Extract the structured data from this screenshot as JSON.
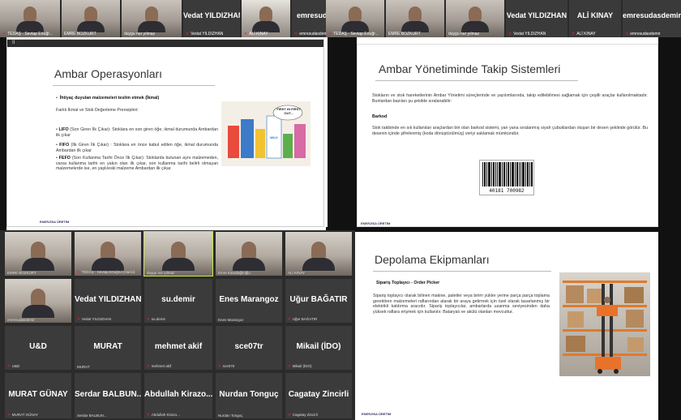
{
  "left_strip": {
    "tiles": [
      {
        "name": "TEDAŞ - Sevtap Ertuğr..."
      },
      {
        "name": "EMRE BOZKURT"
      },
      {
        "name": "duygu nur yılmaz"
      },
      {
        "name": "Vedat YILDIZHAN",
        "big": "Vedat YILDIZHAN"
      },
      {
        "name": "ALİ KINAY"
      },
      {
        "name": "emresudasdemir",
        "big": "emresudasdemir"
      }
    ]
  },
  "right_strip": {
    "tiles": [
      {
        "name": "TEDAŞ - Sevtap Ertuğr..."
      },
      {
        "name": "EMRE BOZKURT"
      },
      {
        "name": "duygu nur yılmaz"
      },
      {
        "name": "Vedat YILDIZHAN",
        "big": "Vedat YILDIZHAN"
      },
      {
        "name": "ALİ KINAY",
        "big": "ALİ KINAY"
      },
      {
        "name": "emresudasdemir",
        "big": "emresudasdemir"
      }
    ]
  },
  "slide1": {
    "bar": "II",
    "title": "Ambar Operasyonları",
    "bullet_main": "İhtiyaç duyulan malzemeleri teslim etmek (İkmal)",
    "subtitle": "Farklı İkmal ve Stok Değerleme Prensipleri:",
    "lifo_key": "LIFO",
    "lifo_text": " (Son Giren İlk Çıkar): Stoklara en son giren öğe, ikmal durumunda Ambardan ilk çıkar",
    "fifo_key": "FIFO",
    "fifo_text": " (İlk Giren İlk Çıkar) : Stoklara en önce kabul edilen öğe, ikmal durumunda Ambardan ilk çıkar",
    "fefo_key": "FEFO",
    "fefo_text": " (Son Kullanma Tarihi Önce İlk Çıkar): Stoklarda bulunan aynı malzemeden, varsa kullanma tarihi en yakın olan ilk çıkar, son kullanma tarihi belirli olmayan malzemelerde ise, en yaşlı/eski malzeme Ambardan ilk çıkar.",
    "cartoon_text1": "FIRST IN FIRST OUT...",
    "cartoon_text2": "MILK",
    "brand": "ENERJİSA ÜRETİM"
  },
  "slide2": {
    "title": "Ambar Yönetiminde Takip Sistemleri",
    "intro": "Stokların ve stok hareketlerinin Ambar Yönetimi süreçlerinde ve yazılımlarında, takip edilebilmesi sağlamak için çeşitli araçlar kullanılmaktadır. Bunlardan bazıları şu şekilde sıralanabilir:",
    "barkod_heading": "Barkod",
    "barkod_text": "Stok takibinde en sık kullanılan araçlardan biri olan barkod sistemi, yan yana sıralanmış siyah çubuklardan oluşan bir desen şeklinde görülür. Bu desenin içinde şifrelenmiş (koda dönüştürülmüş) veriyi saklamak mümkündür.",
    "barcode_number": "40181 700982",
    "brand": "ENERJİSA ÜRETİM"
  },
  "slide3": {
    "title": "Depolama Ekipmanları",
    "heading": "Sipariş Toplayıcı - Order Picker",
    "text": "Sipariş toplayıcı olarak bilinen makine, paletler veya birim yükler yerine parça parça toplama gerektiren malzemeleri raflarından alarak bir araya getirmek için özel olarak tasarlanmış bir elektrikli kaldırma aracıdır. Sipariş toplayıcılar, ambarlarda uzanma seviyesinden daha yüksek raflara erişmek için kullanılır. Bataryalı ve akülü olanları mevcuttur.",
    "brand": "ENERJİSA ÜRETİM"
  },
  "grid": {
    "rows": [
      [
        {
          "name": "EMRE BOZKURT",
          "video": true
        },
        {
          "name": "TEDAŞ - Sevtap Ertuğrul (Harici)",
          "video": true
        },
        {
          "name": "duygu nur yılmaz",
          "video": true,
          "active": true
        },
        {
          "name": "Emre Karadağlıoğlu",
          "video": true
        },
        {
          "name": "ALİ KINAY",
          "video": true
        }
      ],
      [
        {
          "name": "emresudasdemir",
          "video": true
        },
        {
          "name": "Vedat YILDIZHAN",
          "big": "Vedat YILDIZHAN"
        },
        {
          "name": "su.demir",
          "big": "su.demir"
        },
        {
          "name": "Enes Marangoz",
          "big": "Enes Marangoz"
        },
        {
          "name": "Uğur BAĞATIR",
          "big": "Uğur BAĞATIR"
        }
      ],
      [
        {
          "name": "U&D",
          "big": "U&D"
        },
        {
          "name": "MURAT",
          "big": "MURAT"
        },
        {
          "name": "mehmet akif",
          "big": "mehmet akif"
        },
        {
          "name": "sce07tr",
          "big": "sce07tr"
        },
        {
          "name": "Mikail (İDO)",
          "big": "Mikail (İDO)"
        }
      ],
      [
        {
          "name": "MURAT GÜNAY",
          "big": "MURAT GÜNAY"
        },
        {
          "name": "Serdar BALBUN...",
          "big": "Serdar BALBUN..."
        },
        {
          "name": "Abdullah Kirazo...",
          "big": "Abdullah Kirazo..."
        },
        {
          "name": "Nurdan Tonguç",
          "big": "Nurdan Tonguç"
        },
        {
          "name": "Cagatay Zincirli",
          "big": "Cagatay Zincirli"
        }
      ]
    ]
  },
  "colors": {
    "accent": "#c9e84a",
    "mic_off": "#e23333",
    "tile_bg": "#3b3b3b",
    "strip_bg": "#2a2a2a"
  }
}
